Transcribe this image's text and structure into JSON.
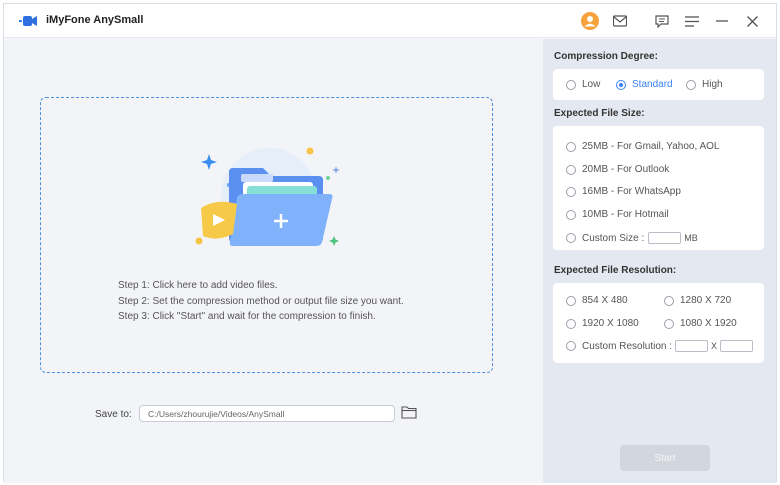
{
  "app": {
    "title": "iMyFone AnySmall"
  },
  "titlebar": {
    "icons": [
      "user-icon",
      "mail-icon",
      "feedback-icon",
      "menu-icon",
      "minimize-icon",
      "close-icon"
    ]
  },
  "main": {
    "steps": [
      "Step 1: Click here to add video files.",
      "Step 2: Set the compression method or output file size you want.",
      "Step 3: Click \"Start\" and wait for the compression to finish."
    ],
    "save_label": "Save to:",
    "save_path": "C:/Users/zhourujie/Videos/AnySmall"
  },
  "sidebar": {
    "compression": {
      "label": "Compression Degree:",
      "options": [
        "Low",
        "Standard",
        "High"
      ],
      "selected": "Standard"
    },
    "file_size": {
      "label": "Expected File Size:",
      "options": [
        "25MB - For Gmail, Yahoo, AOL",
        "20MB - For Outlook",
        "16MB - For WhatsApp",
        "10MB - For Hotmail",
        "Custom Size :"
      ],
      "unit": "MB"
    },
    "resolution": {
      "label": "Expected File Resolution:",
      "options": [
        "854 X 480",
        "1280 X 720",
        "1920 X 1080",
        "1080 X 1920",
        "Custom Resolution :"
      ],
      "separator": "X"
    },
    "start_label": "Start"
  },
  "colors": {
    "accent": "#3b82f6",
    "dashed_border": "#4c8fdb",
    "sidebar_bg": "#e4e8f0"
  }
}
